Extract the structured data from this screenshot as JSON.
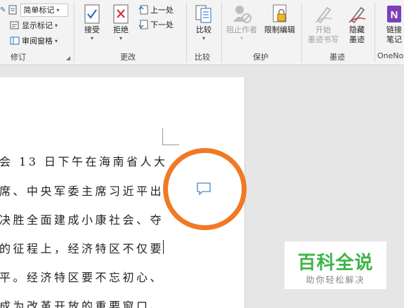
{
  "ribbon": {
    "tracking": {
      "markup_display": "简单标记",
      "show_markup": "显示标记",
      "reviewing_pane": "审阅窗格",
      "group_label": "修订"
    },
    "changes": {
      "accept": "接受",
      "reject": "拒绝",
      "previous": "上一处",
      "next": "下一处",
      "group_label": "更改"
    },
    "compare": {
      "compare": "比较",
      "group_label": "比较"
    },
    "protect": {
      "block_authors": "阻止作者",
      "restrict_editing": "限制编辑",
      "group_label": "保护"
    },
    "ink": {
      "start_inking_1": "开始",
      "start_inking_2": "墨迹书写",
      "hide_ink_1": "隐藏",
      "hide_ink_2": "墨迹",
      "group_label": "墨迹"
    },
    "onenote": {
      "linked_notes_1": "链接",
      "linked_notes_2": "笔记",
      "group_label": "OneNo"
    }
  },
  "document": {
    "lines": [
      "会 13 日下午在海南省人大",
      "席、中央军委主席习近平出",
      "决胜全面建成小康社会、夺",
      "的征程上，经济特区不仅要",
      "平。经济特区要不忘初心、",
      "成为改革开放的重要窗口、"
    ]
  },
  "watermark": {
    "title": "百科全说",
    "subtitle": "助你轻松解决"
  },
  "colors": {
    "highlight_circle": "#f07a24",
    "watermark_green": "#3db44a",
    "onenote_purple": "#7b3fb6",
    "accept_blue": "#2a6ebd",
    "reject_red": "#d13438"
  }
}
